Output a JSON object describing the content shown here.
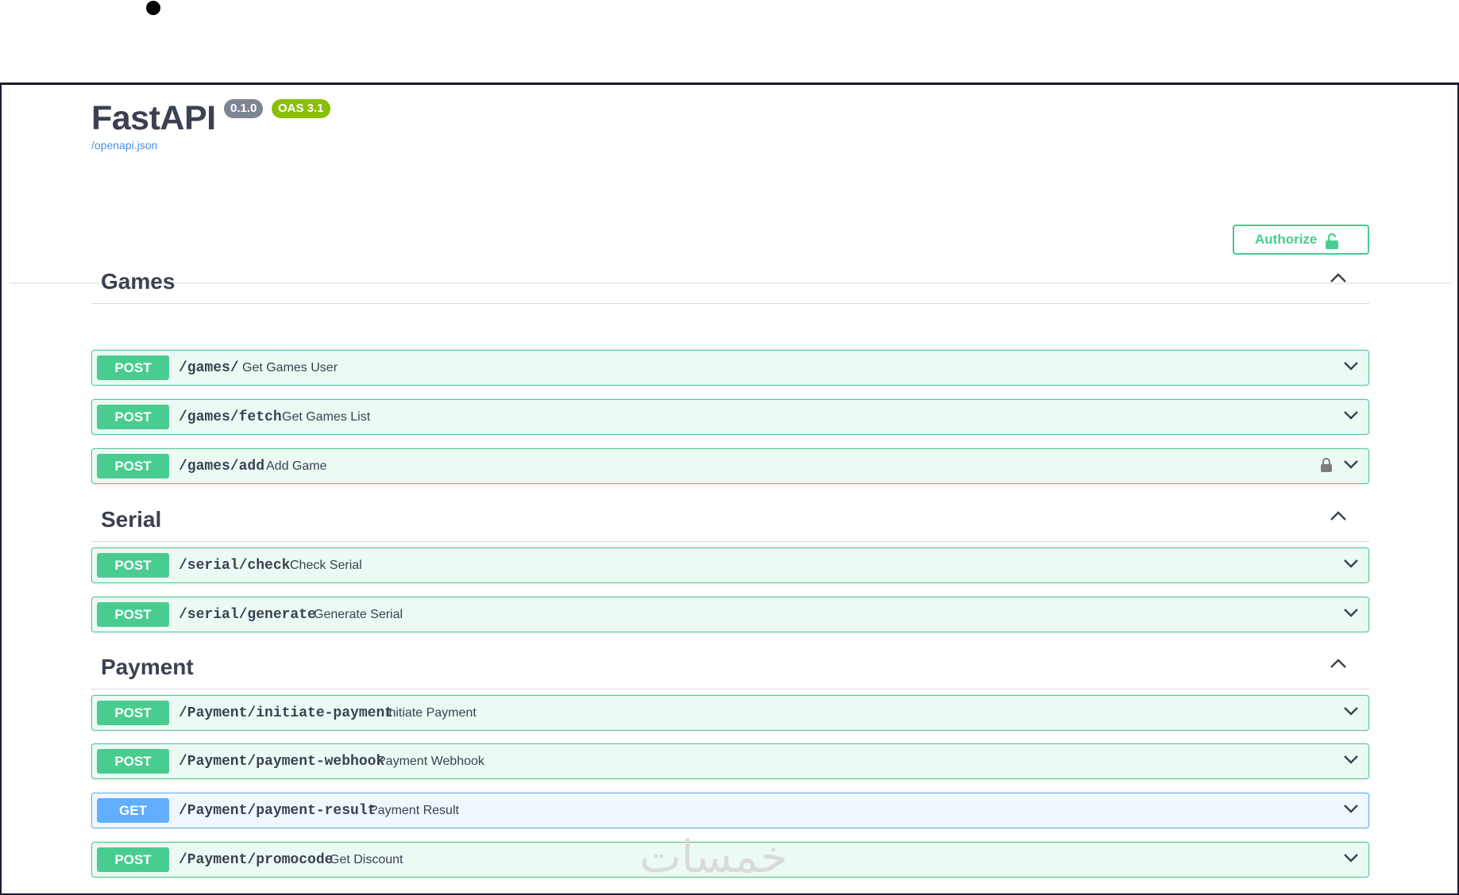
{
  "app": {
    "title": "FastAPI",
    "version_badge": "0.1.0",
    "oas_badge": "OAS 3.1",
    "spec_link": "/openapi.json",
    "authorize_label": "Authorize"
  },
  "colors": {
    "post": "#49cc90",
    "get": "#61affe",
    "version_badge": "#7d8492",
    "oas_badge": "#89bf04",
    "link": "#4990e2"
  },
  "sections": [
    {
      "name": "Games",
      "operations": [
        {
          "method": "POST",
          "path": "/games/",
          "summary": "Get Games User",
          "locked": false
        },
        {
          "method": "POST",
          "path": "/games/fetch",
          "summary": "Get Games List",
          "locked": false
        },
        {
          "method": "POST",
          "path": "/games/add",
          "summary": "Add Game",
          "locked": true
        }
      ]
    },
    {
      "name": "Serial",
      "operations": [
        {
          "method": "POST",
          "path": "/serial/check",
          "summary": "Check Serial",
          "locked": false
        },
        {
          "method": "POST",
          "path": "/serial/generate",
          "summary": "Generate Serial",
          "locked": false
        }
      ]
    },
    {
      "name": "Payment",
      "operations": [
        {
          "method": "POST",
          "path": "/Payment/initiate-payment",
          "summary": "Initiate Payment",
          "locked": false
        },
        {
          "method": "POST",
          "path": "/Payment/payment-webhook",
          "summary": "Payment Webhook",
          "locked": false
        },
        {
          "method": "GET",
          "path": "/Payment/payment-result",
          "summary": "Payment Result",
          "locked": false
        },
        {
          "method": "POST",
          "path": "/Payment/promocode",
          "summary": "Get Discount",
          "locked": false
        }
      ]
    }
  ],
  "watermark": "خمسات"
}
